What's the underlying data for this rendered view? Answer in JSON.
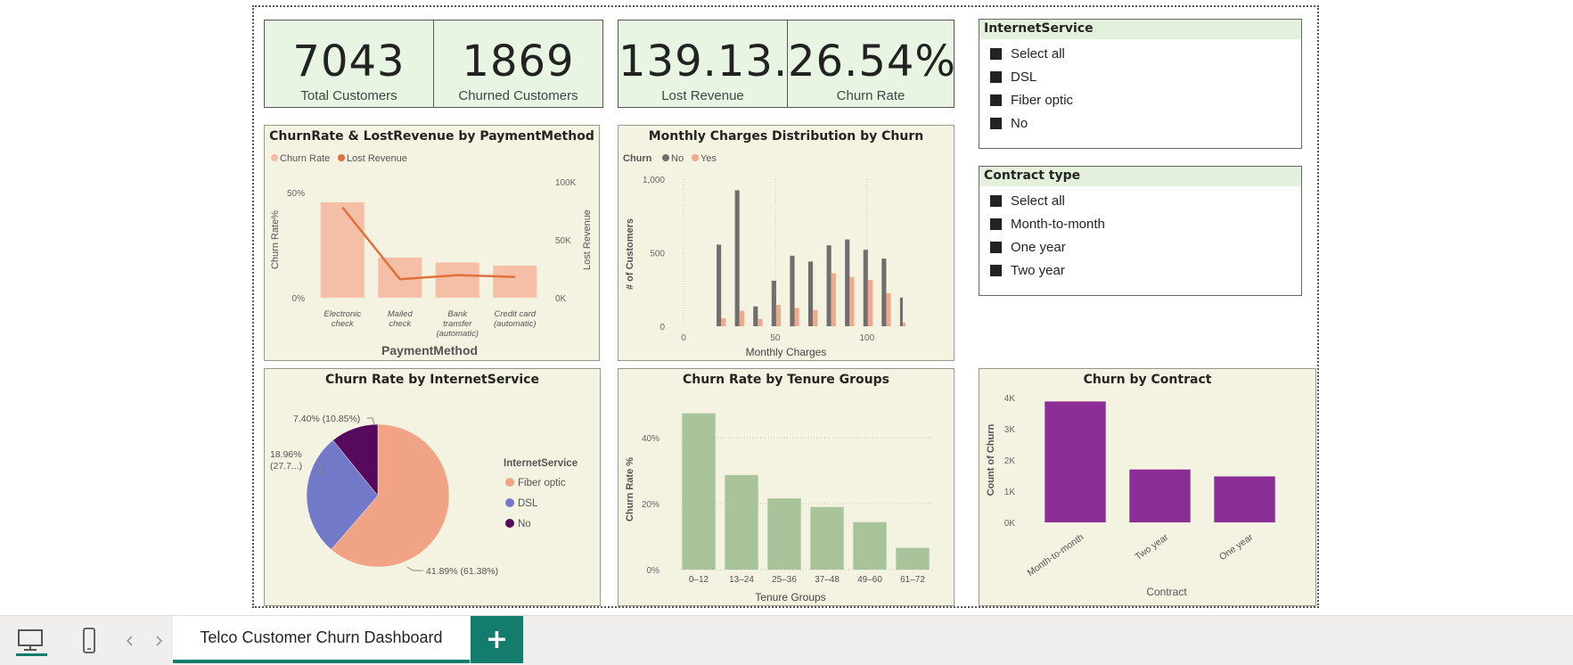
{
  "kpis": [
    {
      "value": "7043",
      "label": "Total Customers"
    },
    {
      "value": "1869",
      "label": "Churned Customers"
    },
    {
      "value": "139.13...",
      "label": "Lost Revenue"
    },
    {
      "value": "26.54%",
      "label": "Churn Rate"
    }
  ],
  "slicers": {
    "internet": {
      "title": "InternetService",
      "items": [
        "Select all",
        "DSL",
        "Fiber optic",
        "No"
      ]
    },
    "contract": {
      "title": "Contract type",
      "items": [
        "Select all",
        "Month-to-month",
        "One year",
        "Two year"
      ]
    }
  },
  "tabs": {
    "active": "Telco Customer Churn Dashboard",
    "add": "+"
  },
  "icons": {
    "desktop": "desktop-icon",
    "mobile": "mobile-icon",
    "prev": "chevron-left-icon",
    "next": "chevron-right-icon"
  },
  "colors": {
    "accent": "#137c6c",
    "churnRate": "#f4bfa6",
    "lostRevenue": "#e0703c",
    "no": "#6f6f6f",
    "yes": "#f0a98a",
    "fiber": "#f0a385",
    "dsl": "#7179c8",
    "noService": "#560a5e",
    "tenure": "#a9c49a",
    "contract": "#8a2e96"
  },
  "chart_data": [
    {
      "type": "bar",
      "title": "ChurnRate & LostRevenue by PaymentMethod",
      "categories": [
        "Electronic check",
        "Mailed check",
        "Bank transfer (automatic)",
        "Credit card (automatic)"
      ],
      "category_lines": [
        [
          "Electronic",
          "check"
        ],
        [
          "Mailed",
          "check"
        ],
        [
          "Bank",
          "transfer",
          "(automatic)"
        ],
        [
          "Credit card",
          "(automatic)"
        ]
      ],
      "series": [
        {
          "name": "Churn Rate",
          "type": "bar",
          "axis": "left",
          "values": [
            45.3,
            19.1,
            16.7,
            15.2
          ]
        },
        {
          "name": "Lost Revenue",
          "type": "line",
          "axis": "right",
          "values": [
            78000,
            16000,
            19500,
            18000
          ]
        }
      ],
      "legend": {
        "position": "top-left",
        "entries": [
          "Churn Rate",
          "Lost Revenue"
        ]
      },
      "xlabel": "PaymentMethod",
      "ylabel": "Churn Rate%",
      "y2label": "Lost Revenue",
      "yticks": [
        "0%",
        "50%"
      ],
      "ylim": [
        0,
        55
      ],
      "y2ticks": [
        "0K",
        "50K",
        "100K"
      ],
      "y2lim": [
        0,
        100000
      ]
    },
    {
      "type": "bar",
      "title": "Monthly Charges Distribution by Churn",
      "legend": {
        "title": "Churn",
        "position": "top-left",
        "entries": [
          "No",
          "Yes"
        ]
      },
      "x": [
        20,
        25,
        35,
        45,
        55,
        65,
        75,
        80,
        90,
        100,
        105,
        115
      ],
      "series": [
        {
          "name": "No",
          "values": [
            555,
            925,
            135,
            310,
            480,
            440,
            550,
            590,
            520,
            460,
            195,
            0
          ]
        },
        {
          "name": "Yes",
          "values": [
            55,
            105,
            50,
            145,
            125,
            110,
            360,
            335,
            315,
            225,
            25,
            0
          ]
        }
      ],
      "xbins": [
        [
          18,
          23
        ],
        [
          28,
          33
        ],
        [
          38,
          43
        ],
        [
          48,
          53
        ],
        [
          58,
          63
        ],
        [
          68,
          73
        ],
        [
          78,
          83
        ],
        [
          88,
          93
        ],
        [
          98,
          103
        ],
        [
          108,
          113
        ],
        [
          118,
          121
        ]
      ],
      "no_values": [
        555,
        925,
        135,
        310,
        480,
        440,
        550,
        590,
        520,
        460,
        195
      ],
      "yes_values": [
        55,
        105,
        50,
        145,
        125,
        110,
        360,
        335,
        315,
        225,
        25
      ],
      "xlabel": "Monthly Charges",
      "ylabel": "# of Customers",
      "xticks": [
        "0",
        "50",
        "100"
      ],
      "xlim": [
        0,
        120
      ],
      "yticks": [
        "0",
        "500",
        "1,000"
      ],
      "ylim": [
        0,
        1000
      ]
    },
    {
      "type": "pie",
      "title": "Churn Rate by InternetService",
      "slices": [
        {
          "name": "Fiber optic",
          "value": 41.89,
          "label": "41.89% (61.38%)"
        },
        {
          "name": "DSL",
          "value": 18.96,
          "label": "18.96% (27.7...)",
          "label_lines": [
            "18.96%",
            "(27.7...)"
          ]
        },
        {
          "name": "No",
          "value": 7.4,
          "label": "7.40% (10.85%)"
        }
      ],
      "legend": {
        "title": "InternetService",
        "position": "right",
        "entries": [
          "Fiber optic",
          "DSL",
          "No"
        ]
      }
    },
    {
      "type": "bar",
      "title": "Churn Rate by Tenure Groups",
      "categories": [
        "0–12",
        "13–24",
        "25–36",
        "37–48",
        "49–60",
        "61–72"
      ],
      "values": [
        47.4,
        28.7,
        21.6,
        19.0,
        14.4,
        6.6
      ],
      "xlabel": "Tenure Groups",
      "ylabel": "Churn Rate %",
      "yticks": [
        "0%",
        "20%",
        "40%"
      ],
      "ylim": [
        0,
        50
      ]
    },
    {
      "type": "bar",
      "title": "Churn by Contract",
      "categories": [
        "Month-to-month",
        "Two year",
        "One year"
      ],
      "values": [
        3875,
        1695,
        1473
      ],
      "xlabel": "Contract",
      "ylabel": "Count of Churn",
      "yticks": [
        "0K",
        "1K",
        "2K",
        "3K",
        "4K"
      ],
      "ylim": [
        0,
        4000
      ]
    }
  ]
}
